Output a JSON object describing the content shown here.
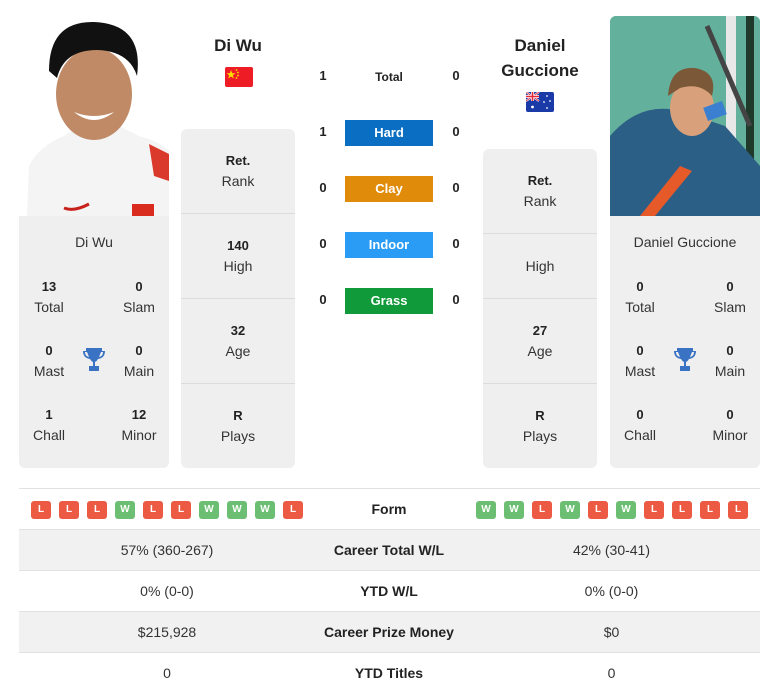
{
  "players": {
    "left": {
      "name": "Di Wu",
      "card_name": "Di Wu",
      "country_flag": "china-flag",
      "photo": "player-photo-di-wu",
      "titles": {
        "total": {
          "value": "13",
          "label": "Total"
        },
        "slam": {
          "value": "0",
          "label": "Slam"
        },
        "mast": {
          "value": "0",
          "label": "Mast"
        },
        "main": {
          "value": "0",
          "label": "Main"
        },
        "chall": {
          "value": "1",
          "label": "Chall"
        },
        "minor": {
          "value": "12",
          "label": "Minor"
        }
      },
      "rank": {
        "value": "Ret.",
        "label": "Rank"
      },
      "high": {
        "value": "140",
        "label": "High"
      },
      "age": {
        "value": "32",
        "label": "Age"
      },
      "plays": {
        "value": "R",
        "label": "Plays"
      }
    },
    "right": {
      "name_line1": "Daniel",
      "name_line2": "Guccione",
      "card_name": "Daniel Guccione",
      "country_flag": "australia-flag",
      "photo": "player-photo-daniel-guccione",
      "titles": {
        "total": {
          "value": "0",
          "label": "Total"
        },
        "slam": {
          "value": "0",
          "label": "Slam"
        },
        "mast": {
          "value": "0",
          "label": "Mast"
        },
        "main": {
          "value": "0",
          "label": "Main"
        },
        "chall": {
          "value": "0",
          "label": "Chall"
        },
        "minor": {
          "value": "0",
          "label": "Minor"
        }
      },
      "rank": {
        "value": "Ret.",
        "label": "Rank"
      },
      "high": {
        "value": "",
        "label": "High"
      },
      "age": {
        "value": "27",
        "label": "Age"
      },
      "plays": {
        "value": "R",
        "label": "Plays"
      }
    }
  },
  "h2h": {
    "total": {
      "label": "Total",
      "left": "1",
      "right": "0"
    },
    "surfaces": [
      {
        "label": "Hard",
        "left": "1",
        "right": "0",
        "color": "#0a6ec2"
      },
      {
        "label": "Clay",
        "left": "0",
        "right": "0",
        "color": "#e08c0a"
      },
      {
        "label": "Indoor",
        "left": "0",
        "right": "0",
        "color": "#2a9cf5"
      },
      {
        "label": "Grass",
        "left": "0",
        "right": "0",
        "color": "#119a3a"
      }
    ]
  },
  "form": {
    "label": "Form",
    "left": [
      "L",
      "L",
      "L",
      "W",
      "L",
      "L",
      "W",
      "W",
      "W",
      "L"
    ],
    "right": [
      "W",
      "W",
      "L",
      "W",
      "L",
      "W",
      "L",
      "L",
      "L",
      "L"
    ]
  },
  "stats_table": [
    {
      "label": "Career Total W/L",
      "left": "57% (360-267)",
      "right": "42% (30-41)"
    },
    {
      "label": "YTD W/L",
      "left": "0% (0-0)",
      "right": "0% (0-0)"
    },
    {
      "label": "Career Prize Money",
      "left": "$215,928",
      "right": "$0"
    },
    {
      "label": "YTD Titles",
      "left": "0",
      "right": "0"
    }
  ]
}
